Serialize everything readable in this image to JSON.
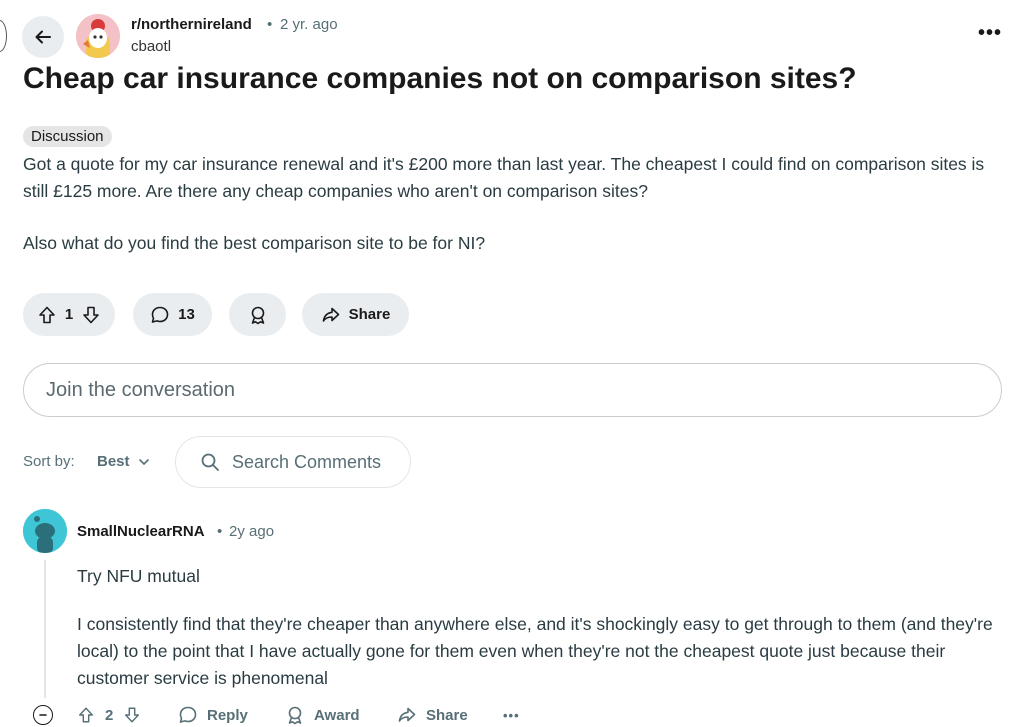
{
  "post": {
    "subreddit": "r/northernireland",
    "separator": "•",
    "age": "2 yr. ago",
    "author": "cbaotl",
    "more": "•••",
    "title": "Cheap car insurance companies not on comparison sites?",
    "flair": "Discussion",
    "body_p1": "Got a quote for my car insurance renewal and it's £200 more than last year. The cheapest I could find on comparison sites is still £125 more. Are there any cheap companies who aren't on comparison sites?",
    "body_p2": "Also what do you find the best comparison site to be for NI?",
    "votes": "1",
    "comments": "13",
    "share_label": "Share"
  },
  "join": {
    "placeholder": "Join the conversation"
  },
  "sort": {
    "label": "Sort by:",
    "value": "Best"
  },
  "search": {
    "placeholder": "Search Comments"
  },
  "comment": {
    "author": "SmallNuclearRNA",
    "separator": "•",
    "age": "2y ago",
    "p1": "Try NFU mutual",
    "p2": "I consistently find that they're cheaper than anywhere else, and it's shockingly easy to get through to them (and they're local) to the point that I have actually gone for them even when they're not the cheapest quote just because their customer service is phenomenal",
    "votes": "2",
    "reply_label": "Reply",
    "award_label": "Award",
    "share_label": "Share",
    "more": "•••"
  },
  "colors": {
    "pill_bg": "#eaedef",
    "text": "#1a1a1b",
    "meta": "#576f76",
    "avatar_teal": "#3fc6d6"
  }
}
